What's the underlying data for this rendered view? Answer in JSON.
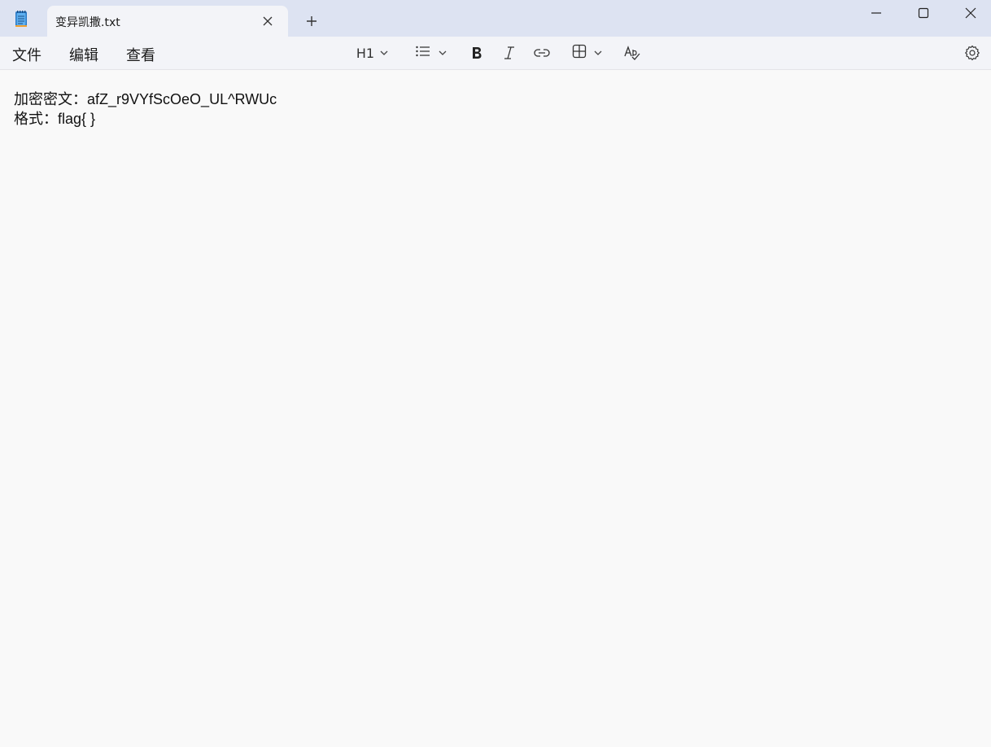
{
  "window": {
    "app_icon": "notepad-icon",
    "tab_title": "变异凯撒.txt",
    "close_tab_icon": "close-icon",
    "new_tab_icon": "plus-icon",
    "controls": [
      "minimize-icon",
      "maximize-icon",
      "close-icon"
    ]
  },
  "menu": {
    "file": "文件",
    "edit": "编辑",
    "view": "查看"
  },
  "toolbar": {
    "heading_label": "H1",
    "items": [
      "heading-dropdown",
      "list-dropdown",
      "bold-icon",
      "italic-icon",
      "link-icon",
      "table-dropdown",
      "spellcheck-icon",
      "settings-icon"
    ]
  },
  "editor": {
    "lines": [
      "加密密文：afZ_r9VYfScOeO_UL^RWUc",
      "格式：flag{ }"
    ]
  }
}
